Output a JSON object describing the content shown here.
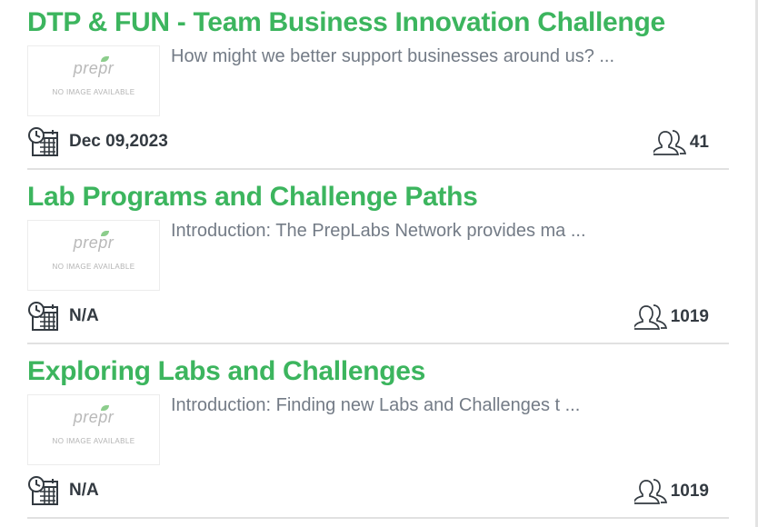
{
  "items": [
    {
      "title": "DTP & FUN - Team Business Innovation Challenge",
      "description": "How might we better support businesses around us? ...",
      "thumbnail": {
        "logo": "prepr",
        "caption": "NO IMAGE AVAILABLE"
      },
      "date": "Dec 09,2023",
      "participants": "41"
    },
    {
      "title": "Lab Programs and Challenge Paths",
      "description": "Introduction: The PrepLabs Network provides ma ...",
      "thumbnail": {
        "logo": "prepr",
        "caption": "NO IMAGE AVAILABLE"
      },
      "date": "N/A",
      "participants": "1019"
    },
    {
      "title": "Exploring Labs and Challenges",
      "description": "Introduction: Finding new Labs and Challenges t ...",
      "thumbnail": {
        "logo": "prepr",
        "caption": "NO IMAGE AVAILABLE"
      },
      "date": "N/A",
      "participants": "1019"
    }
  ],
  "icons": {
    "date": "calendar-clock-icon",
    "participants": "users-icon"
  },
  "colors": {
    "title": "#3cb55e",
    "description": "#737b86",
    "meta_text": "#333a41",
    "divider": "#e1e1e1"
  }
}
